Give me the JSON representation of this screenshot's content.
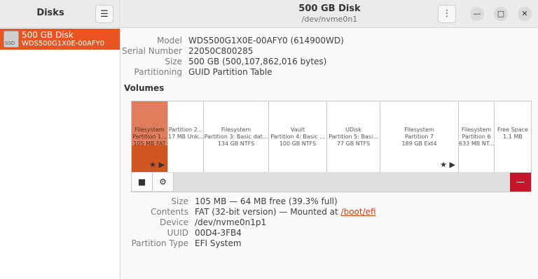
{
  "sidebar": {
    "title": "Disks",
    "menu_icon": "hamburger-menu-icon",
    "disks": [
      {
        "icon": "ssd-icon",
        "icon_text": "SSD",
        "name": "500 GB Disk",
        "model": "WDS500G1X0E-00AFY0"
      }
    ]
  },
  "header": {
    "title": "500 GB Disk",
    "subtitle": "/dev/nvme0n1",
    "kebab_icon": "kebab-menu-icon",
    "minimize_glyph": "—",
    "maximize_glyph": "□",
    "close_glyph": "✕"
  },
  "disk_info": {
    "model_label": "Model",
    "model_value": "WDS500G1X0E-00AFY0 (614900WD)",
    "serial_label": "Serial Number",
    "serial_value": "22050C800285",
    "size_label": "Size",
    "size_value": "500 GB (500,107,862,016 bytes)",
    "partitioning_label": "Partitioning",
    "partitioning_value": "GUID Partition Table"
  },
  "volumes": {
    "heading": "Volumes",
    "segments": [
      {
        "line1": "Filesystem",
        "line2": "Partition 1...",
        "line3": "105 MB FAT",
        "selected": true,
        "icons": "★ ▶"
      },
      {
        "line1": "",
        "line2": "Partition 2...",
        "line3": "17 MB Unk...",
        "selected": false,
        "icons": ""
      },
      {
        "line1": "Filesystem",
        "line2": "Partition 3: Basic dat...",
        "line3": "134 GB NTFS",
        "selected": false,
        "icons": ""
      },
      {
        "line1": "Vault",
        "line2": "Partition 4: Basic ...",
        "line3": "100 GB NTFS",
        "selected": false,
        "icons": ""
      },
      {
        "line1": "UDisk",
        "line2": "Partition 5: Basi...",
        "line3": "77 GB NTFS",
        "selected": false,
        "icons": ""
      },
      {
        "line1": "Filesystem",
        "line2": "Partition 7",
        "line3": "189 GB Ext4",
        "selected": false,
        "icons": "★ ▶"
      },
      {
        "line1": "Filesystem",
        "line2": "Partition 6",
        "line3": "633 MB NT...",
        "selected": false,
        "icons": ""
      },
      {
        "line1": "Free Space",
        "line2": "1.1 MB",
        "line3": "",
        "selected": false,
        "icons": ""
      }
    ],
    "toolbar": {
      "stop_glyph": "■",
      "settings_glyph": "⚙",
      "delete_glyph": "—"
    }
  },
  "partition_info": {
    "size_label": "Size",
    "size_value": "105 MB — 64 MB free (39.3% full)",
    "contents_label": "Contents",
    "contents_value": "FAT (32-bit version) — Mounted at ",
    "contents_link": "/boot/efi",
    "device_label": "Device",
    "device_value": "/dev/nvme0n1p1",
    "uuid_label": "UUID",
    "uuid_value": "00D4-3FB4",
    "type_label": "Partition Type",
    "type_value": "EFI System"
  }
}
